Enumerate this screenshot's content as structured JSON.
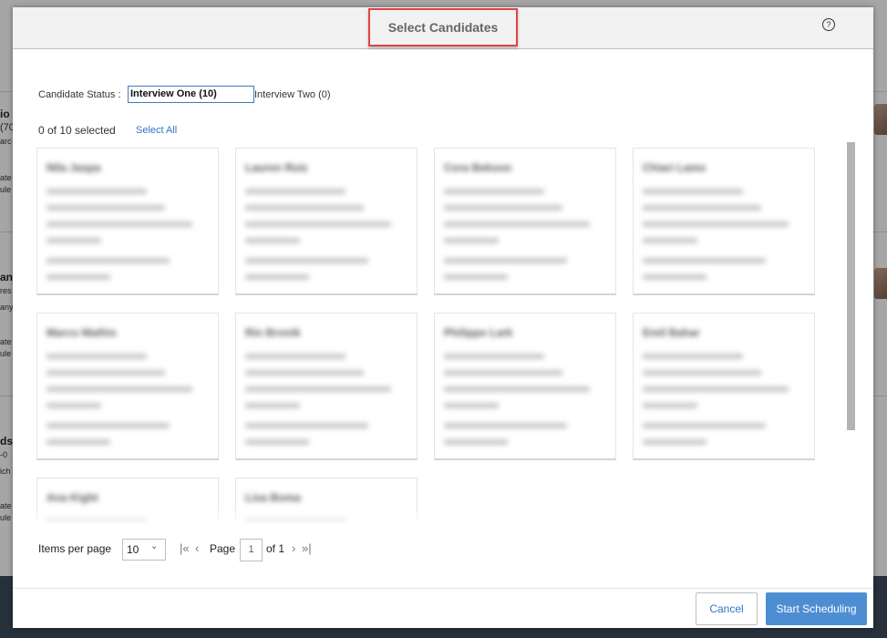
{
  "dialog": {
    "title": "Select Candidates",
    "help_icon": "help-circle-icon",
    "help_glyph": "?"
  },
  "status": {
    "label": "Candidate Status :",
    "selected": "Interview One (10)",
    "other": "Interview Two (0)"
  },
  "selection": {
    "count_text": "0 of 10 selected",
    "select_all": "Select All"
  },
  "candidates": [
    {
      "name": "Nila Jaspa"
    },
    {
      "name": "Lauren Ruiz"
    },
    {
      "name": "Cora Bekson"
    },
    {
      "name": "Chiari Lamo"
    },
    {
      "name": "Marco Mathis"
    },
    {
      "name": "Rin Bronik"
    },
    {
      "name": "Philippe Lark"
    },
    {
      "name": "Emil Bahar"
    },
    {
      "name": "Ana Kight"
    },
    {
      "name": "Lisa Boma"
    }
  ],
  "pagination": {
    "items_per_page_label": "Items per page",
    "items_per_page": "10",
    "page_label": "Page",
    "page": "1",
    "of_total": "of 1",
    "first_glyph": "|«",
    "prev_glyph": "‹",
    "next_glyph": "›",
    "last_glyph": "»|",
    "dropdown_glyph": "⌄"
  },
  "footer": {
    "cancel": "Cancel",
    "start": "Start Scheduling"
  },
  "background": {
    "snippets": [
      "io",
      "(70",
      "arc",
      "ate",
      "ule",
      "an",
      "res",
      "any",
      "ate",
      "ule",
      "ds",
      "-0",
      "ich",
      "ate",
      "ule"
    ]
  },
  "colors": {
    "accent": "#2e76c7",
    "primary_button": "#4d8ed3",
    "title_highlight": "#e04444"
  }
}
